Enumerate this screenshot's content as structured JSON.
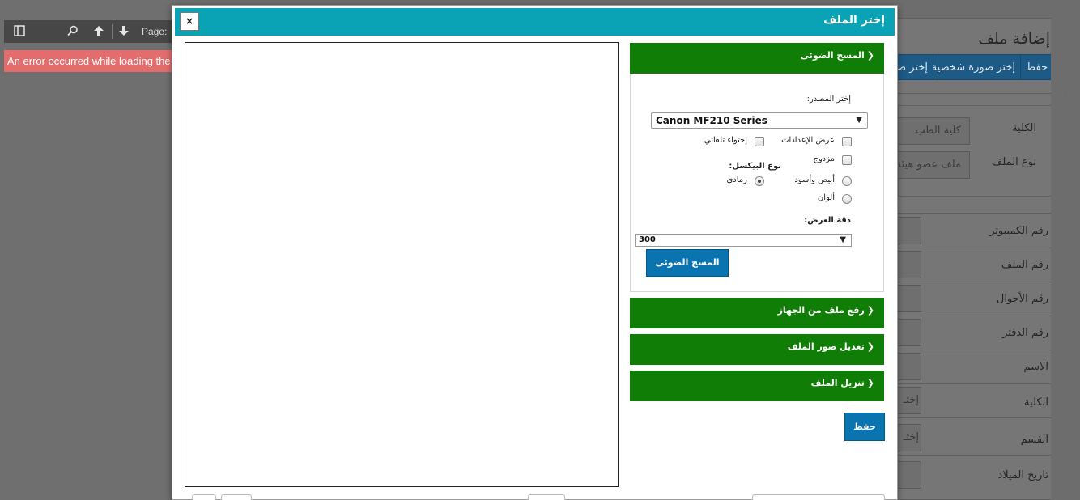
{
  "pdf_viewer": {
    "toolbar": {
      "sidebar_icon": "sidebar-toggle-icon",
      "search_icon": "search-icon",
      "prev_icon": "arrow-up-icon",
      "next_icon": "arrow-down-icon",
      "page_label": "Page:"
    },
    "error_text": "An error occurred while loading the"
  },
  "background_page": {
    "title": "إضافة ملف",
    "buttons": [
      "حفظ",
      "إختر صورة شخصية",
      "إختر صو"
    ],
    "filters": [
      {
        "label": "الكلية",
        "value": "كلية الطب"
      },
      {
        "label": "نوع الملف",
        "value": "ملف عضو هيئة"
      }
    ],
    "fields": [
      {
        "label": "رقم الكمبيوتر",
        "value": ""
      },
      {
        "label": "رقم الملف",
        "value": ""
      },
      {
        "label": "رقم الأحوال",
        "value": ""
      },
      {
        "label": "رقم الدفتر",
        "value": ""
      },
      {
        "label": "الاسم",
        "value": ""
      },
      {
        "label": "الكلية",
        "value": "إختـ"
      },
      {
        "label": "القسم",
        "value": "إختـ"
      },
      {
        "label": "تاريخ الميلاد",
        "value": ""
      }
    ]
  },
  "modal": {
    "title": "إختر الملف",
    "close_label": "×",
    "accordion": [
      {
        "label": "المسح الضوئى"
      },
      {
        "label": "رفع ملف من الجهاز"
      },
      {
        "label": "تعديل صور الملف"
      },
      {
        "label": "تنزيل الملف"
      }
    ],
    "scan": {
      "source_label": "إختر المصدر:",
      "source_value": "Canon MF210 Series",
      "show_settings": "عرض الإعدادات",
      "auto_contain": "إحتواء تلقائي",
      "duplex": "مزدوج",
      "pixel_type_label": "نوع البيكسل:",
      "pixel_options": [
        {
          "label": "أبيض وأسود",
          "checked": false
        },
        {
          "label": "رمادى",
          "checked": true
        },
        {
          "label": "ألوان",
          "checked": false
        }
      ],
      "resolution_label": "دقة العرض:",
      "resolution_value": "300",
      "scan_button": "المسح الضوئى"
    },
    "save_button": "حفظ",
    "colors": {
      "header": "#0aa3b5",
      "accordion": "#0f7d06",
      "primary_button": "#0a74b0",
      "error": "#e36d6d"
    }
  }
}
